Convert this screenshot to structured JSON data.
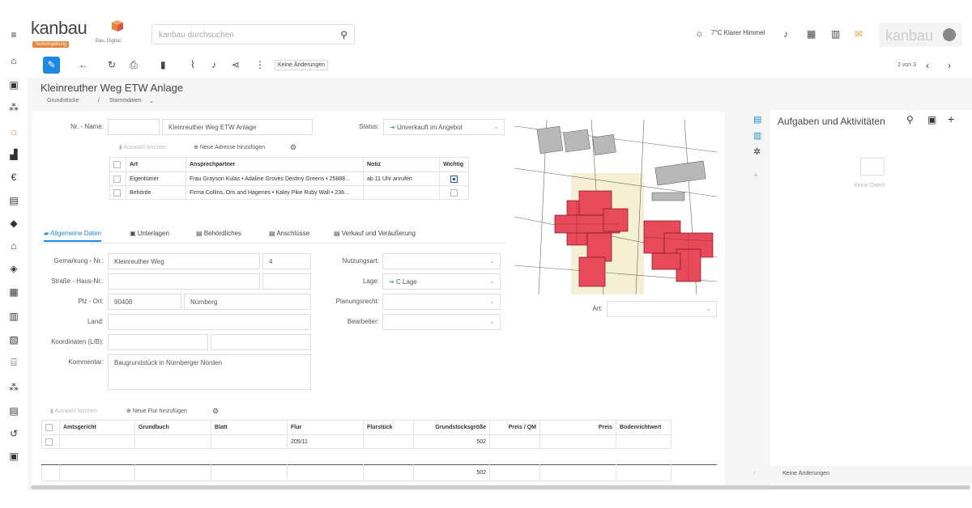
{
  "app": {
    "logo": "kanbau",
    "tagline": "Bau. Digital.",
    "badge": "Testumgebung",
    "search_placeholder": "kanbau durchsuchen",
    "weather": "7°C  Klarer Himmel",
    "user_label": "kanbau"
  },
  "sidebar": {
    "icons": [
      "menu-icon",
      "home-icon",
      "contacts-icon",
      "people-icon",
      "property-icon",
      "buildings-icon",
      "euro-icon",
      "card-icon",
      "tag-icon",
      "house-icon",
      "shield-icon",
      "calendar-icon",
      "report-icon",
      "blueprint-icon",
      "bank-icon",
      "team-icon",
      "list-icon",
      "history-icon",
      "payment-icon"
    ]
  },
  "toolbar": {
    "status_chip": "Keine Änderungen",
    "pager": "2 von 3"
  },
  "page": {
    "title": "Kleinreuther Weg ETW Anlage",
    "breadcrumb": [
      "Grundstücke",
      "Stammdaten"
    ]
  },
  "form_top": {
    "nr_name_label": "Nr. - Name:",
    "nr_value": "",
    "name_value": "Kleinreuther Weg ETW Anlage",
    "status_label": "Status:",
    "status_value": "Unverkauft im Angebot"
  },
  "address_actions": {
    "delete": "Auswahl löschen",
    "add": "Neue Adresse hinzufügen"
  },
  "address_table": {
    "headers": [
      "Art",
      "Ansprechpartner",
      "Notiz",
      "Wichtig"
    ],
    "rows": [
      {
        "art": "Eigentümer",
        "partner": "Frau Grayson Kulas • Adaline Groves Destiny Greens • 25888...",
        "notiz": "ab 11 Uhr anrufen",
        "wichtig": true
      },
      {
        "art": "Behörde",
        "partner": "Firma Collins, Orn and Hagenes • Kaley Pike Ruby Wall • 238...",
        "notiz": "",
        "wichtig": false
      }
    ]
  },
  "tabs": [
    "Allgemeine Daten",
    "Unterlagen",
    "Behördliches",
    "Anschlüsse",
    "Verkauf und Veräußerung"
  ],
  "form": {
    "gemarkung_label": "Gemarkung - Nr.:",
    "gemarkung_value": "Kleinreuther Weg",
    "gemarkung_nr": "4",
    "strasse_label": "Straße - Haus-Nr.:",
    "plz_label": "Plz - Ort:",
    "plz_value": "90408",
    "ort_value": "Nürnberg",
    "land_label": "Land:",
    "koord_label": "Koordinaten (L/B):",
    "kommentar_label": "Kommentar:",
    "kommentar_value": "Baugrundstück in Nürnberger Norden",
    "nutzungsart_label": "Nutzungsart:",
    "lage_label": "Lage:",
    "lage_value": "C Lage",
    "planungsrecht_label": "Planungsrecht:",
    "bearbeiter_label": "Bearbeiter:",
    "art_label": "Art:"
  },
  "flur_actions": {
    "delete": "Auswahl löschen",
    "add": "Neue Flur hinzufügen"
  },
  "flur_table": {
    "headers": [
      "Amtsgericht",
      "Grundbuch",
      "Blatt",
      "Flur",
      "Flurstück",
      "Grundstücksgröße",
      "Preis / QM",
      "Preis",
      "Bodenrichtwert"
    ],
    "row": {
      "flur": "205/11",
      "groesse": "502"
    },
    "sum": {
      "groesse": "502"
    }
  },
  "tasks_panel": {
    "title": "Aufgaben und Aktivitäten",
    "empty": "Keine Daten",
    "footer": "Keine Änderungen"
  },
  "colors": {
    "accent": "#1e88e5",
    "parcel": "#e84a5a",
    "status_arrow": "#4caf50",
    "badge": "#e8833a"
  }
}
